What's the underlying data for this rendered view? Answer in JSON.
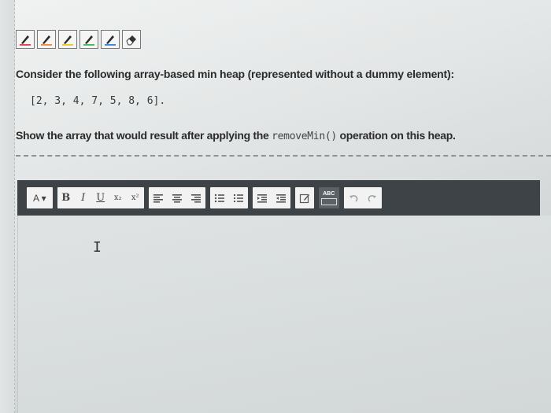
{
  "palette": {
    "tools": [
      {
        "name": "red-highlighter-icon",
        "color": "#e04a4a"
      },
      {
        "name": "orange-highlighter-icon",
        "color": "#f0903a"
      },
      {
        "name": "yellow-highlighter-icon",
        "color": "#e6cf2c"
      },
      {
        "name": "green-highlighter-icon",
        "color": "#4dbb5a"
      },
      {
        "name": "blue-highlighter-icon",
        "color": "#3b8de0"
      },
      {
        "name": "eraser-icon",
        "color": "#333333"
      }
    ]
  },
  "question": {
    "text": "Consider the following array-based min heap (represented without a dummy element):",
    "array": "[2, 3, 4, 7, 5, 8, 6].",
    "instruction_before": "Show the array that would result after applying the ",
    "instruction_code": "removeMin()",
    "instruction_after": " operation on this heap."
  },
  "toolbar": {
    "font_label": "A ▾",
    "bold": "B",
    "italic": "I",
    "underline": "U",
    "subscript": "x₂",
    "superscript": "x²",
    "spellcheck": "ABC"
  }
}
